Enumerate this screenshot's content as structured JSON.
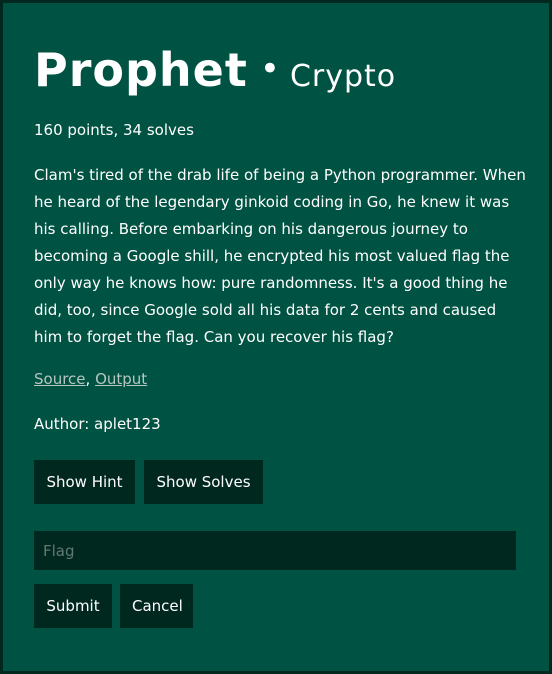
{
  "challenge": {
    "name": "Prophet",
    "separator": "•",
    "category": "Crypto",
    "meta": "160 points, 34 solves",
    "description": "Clam's tired of the drab life of being a Python programmer. When he heard of the legendary ginkoid coding in Go, he knew it was his calling. Before embarking on his dangerous journey to becoming a Google shill, he encrypted his most valued flag the only way he knows how: pure randomness. It's a good thing he did, too, since Google sold all his data for 2 cents and caused him to forget the flag. Can you recover his flag?",
    "links": [
      {
        "label": "Source"
      },
      {
        "label": "Output"
      }
    ],
    "link_separator": ", ",
    "author": "Author: aplet123"
  },
  "buttons": {
    "hint": "Show Hint",
    "solves": "Show Solves",
    "submit": "Submit",
    "cancel": "Cancel"
  },
  "flag_input": {
    "placeholder": "Flag",
    "value": ""
  },
  "colors": {
    "card_background": "#005242",
    "page_background": "#00281f",
    "button_background": "#00281f",
    "text": "#ffffff",
    "link": "#b8c6c2",
    "placeholder": "#607a73"
  }
}
